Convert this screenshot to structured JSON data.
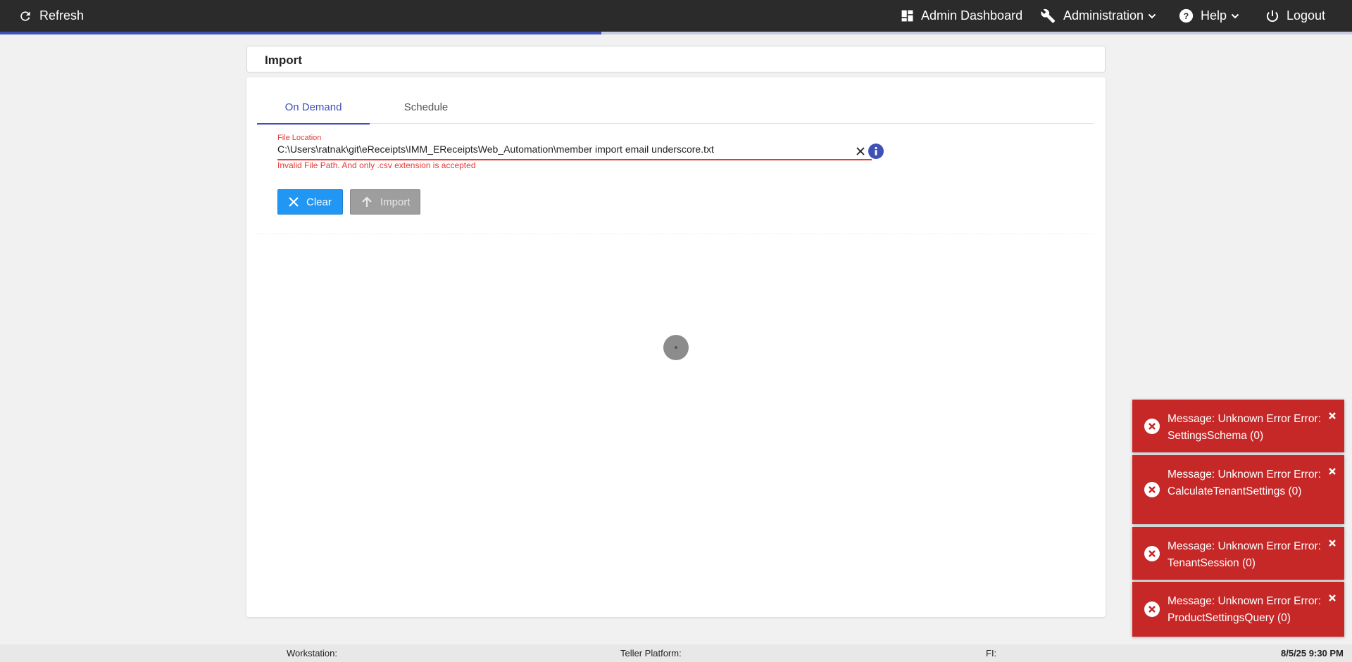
{
  "topbar": {
    "refresh_label": "Refresh",
    "admin_dashboard_label": "Admin Dashboard",
    "administration_label": "Administration",
    "help_label": "Help",
    "logout_label": "Logout",
    "loading_progress": 0.445
  },
  "header": {
    "title": "Import"
  },
  "tabs": [
    {
      "label": "On Demand",
      "active": true
    },
    {
      "label": "Schedule",
      "active": false
    }
  ],
  "file_field": {
    "label": "File Location",
    "value": "C:\\Users\\ratnak\\git\\eReceipts\\IMM_EReceiptsWeb_Automation\\member import email underscore.txt",
    "error": "Invalid File Path. And only .csv extension is accepted"
  },
  "buttons": {
    "clear_label": "Clear",
    "import_label": "Import"
  },
  "toasts": [
    {
      "message": "Message: Unknown Error Error: SettingsSchema (0)"
    },
    {
      "message": "Message: Unknown Error Error: CalculateTenantSettings (0)"
    },
    {
      "message": "Message: Unknown Error Error: TenantSession (0)"
    },
    {
      "message": "Message: Unknown Error Error: ProductSettingsQuery (0)"
    }
  ],
  "footer": {
    "workstation_label": "Workstation:",
    "teller_platform_label": "Teller Platform:",
    "fi_label": "FI:",
    "datetime": "8/5/25 9:30 PM"
  },
  "colors": {
    "accent": "#3f51b5",
    "error": "#e53935",
    "toast": "#c62828",
    "clear_button": "#2196f3",
    "topbar": "#2b2b2b"
  }
}
